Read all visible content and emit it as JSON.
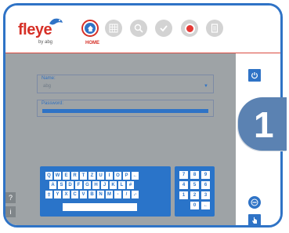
{
  "brand": {
    "logo_text": "fleye",
    "logo_sub": "by abg"
  },
  "nav": {
    "items": [
      {
        "name": "home",
        "label": "HOME",
        "icon": "home-icon",
        "active": true
      },
      {
        "name": "grid",
        "icon": "grid-icon"
      },
      {
        "name": "search",
        "icon": "search-icon"
      },
      {
        "name": "check",
        "icon": "check-icon"
      },
      {
        "name": "record",
        "icon": "record-icon"
      },
      {
        "name": "document",
        "icon": "document-icon"
      }
    ]
  },
  "login": {
    "name_label": "Name:",
    "name_value": "abg",
    "password_label": "Password:"
  },
  "keyboard": {
    "row1": [
      "Q",
      "W",
      "E",
      "R",
      "T",
      "Z",
      "U",
      "I",
      "O",
      "P",
      "←"
    ],
    "row2": [
      "A",
      "S",
      "D",
      "F",
      "G",
      "H",
      "J",
      "K",
      "L",
      "#"
    ],
    "row3": [
      "⇧",
      "Y",
      "X",
      "C",
      "V",
      "B",
      "N",
      "M",
      "-",
      "/",
      ".-"
    ]
  },
  "numpad": {
    "row1": [
      "7",
      "8",
      "9"
    ],
    "row2": [
      "4",
      "5",
      "6"
    ],
    "row3": [
      "1",
      "2",
      "3"
    ],
    "row4": [
      "0",
      "←"
    ]
  },
  "side": {
    "help": "?",
    "info": "i"
  },
  "badge": {
    "number": "1"
  },
  "colors": {
    "accent": "#2f73c6",
    "brand_red": "#d63027",
    "panel_gray": "#9ea3a6"
  }
}
